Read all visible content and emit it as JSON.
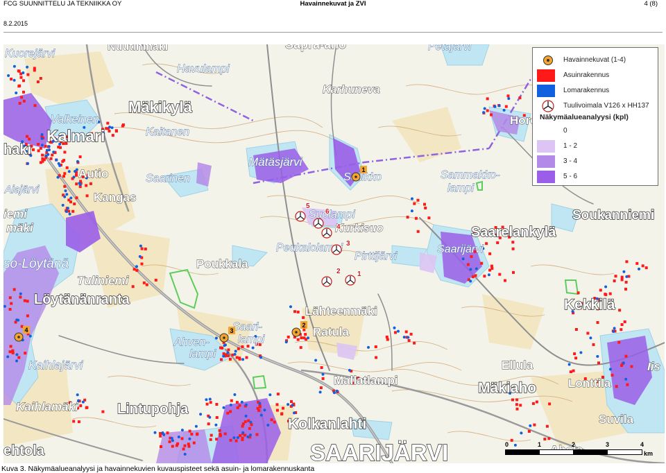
{
  "header": {
    "company": "FCG SUUNNITTELU JA TEKNIIKKA OY",
    "title": "Havainnekuvat ja ZVI",
    "page": "4 (8)",
    "date": "8.2.2015"
  },
  "colors": {
    "asuinrakennus": "#ff1a1a",
    "lomarakennus": "#1060e0",
    "class_0": "#ffffff",
    "class_1_2": "#dcc4f4",
    "class_3_4": "#b48ae8",
    "class_5_6": "#9a5ee8",
    "water": "#bfe6f2",
    "road_main": "#8a8a8a",
    "powerline": "#8f63e0"
  },
  "legend": {
    "items": [
      {
        "icon": "camera-viewpoint-icon",
        "label": "Havainnekuvat (1-4)"
      },
      {
        "icon": "red-square",
        "label": "Asuinrakennus"
      },
      {
        "icon": "blue-square",
        "label": "Lomarakennus"
      },
      {
        "icon": "wind-turbine-icon",
        "label": "Tuulivoimala V126 x HH137"
      }
    ],
    "heading": "Näkymäalueanalyysi (kpl)",
    "classes": [
      {
        "label": "0",
        "color": "#ffffff"
      },
      {
        "label": "1 - 2",
        "color": "#dcc4f4"
      },
      {
        "label": "3 - 4",
        "color": "#b48ae8"
      },
      {
        "label": "5 - 6",
        "color": "#9a5ee8"
      }
    ]
  },
  "place_names": {
    "kuorejarvi": "Kuorejärvi",
    "nuutinmaki": "Nuutinmäki",
    "saprapuolen": "Sapra-aho",
    "petaajarvi": "Petäjärvi",
    "havulampi": "Havulampi",
    "karhuneva": "Karhuneva",
    "makikyla": "Mäkikylä",
    "valkeinen": "Valkeinen",
    "kalmari": "Kalmari",
    "kaitanen": "Kaitanen",
    "horo": "Horo",
    "haki": "hakı",
    "matasjarvi": "Mätäsjärvi",
    "autio": "Autio",
    "saarinen": "Saarinen",
    "soilikko": "Soilikko",
    "sammakkolampi_a": "Sammakko-",
    "sammakkolampi_b": "lampi",
    "aiajarvi": "Aiajärvi",
    "kangas": "Kangas",
    "niemi": "iemi",
    "maki": "mäki",
    "suolampi": "Suolampi",
    "soukanniemi": "Soukanniemi",
    "kurkisuo": "Kurkisuo",
    "saarelankyla": "Saarelankylä",
    "peukalolampi": "Peukalolampi",
    "saarijarvi_lake": "Saarijärvi",
    "pirttijarvi": "Pirttijärvi",
    "soloytana": "so-Löytänä",
    "poukkala": "Poukkala",
    "tuliniemi": "Tuliniemi",
    "loytananranta": "Löytänänranta",
    "kekkila": "Kekkilä",
    "lahteenmaki": "Lähteenmäki",
    "saarilampi_a": "Saari-",
    "saarilampi_b": "lampi",
    "ratula": "Ratula",
    "ahvenlampi_a": "Ahven-",
    "ahvenlampi_b": "lampi",
    "kaihlajarvi": "Kaihlajärvi",
    "ellula": "Ellula",
    "iis": "Iis",
    "mallatlampi": "Mallatlampi",
    "makiaho": "Mäkiaho",
    "lonttila": "Lonttila",
    "kaihlamaki": "Kaihlamäki",
    "lintupohja": "Lintupohja",
    "suvila": "Suvila",
    "kolkanlahti": "Kolkanlahti",
    "saarijarvi_town": "SAARIJÄRVI",
    "ahola": "Ahola",
    "entola": "ehtola"
  },
  "turbine_numbers": [
    "1",
    "2",
    "3",
    "4",
    "5",
    "6"
  ],
  "viewpoint_numbers": [
    "1",
    "2",
    "3",
    "4"
  ],
  "scalebar": {
    "ticks": [
      "0",
      "1",
      "2",
      "3",
      "4"
    ],
    "unit": "km"
  },
  "caption": "Kuva 3. Näkymäalueanalyysi ja havainnekuvien kuvauspisteet sekä asuin- ja lomarakennuskanta"
}
